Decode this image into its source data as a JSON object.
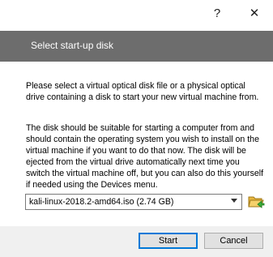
{
  "titlebar": {
    "help_label": "?",
    "close_label": "✕"
  },
  "header": {
    "title": "Select start-up disk"
  },
  "body": {
    "paragraph1": "Please select a virtual optical disk file or a physical optical drive containing a disk to start your new virtual machine from.",
    "paragraph2": "The disk should be suitable for starting a computer from and should contain the operating system you wish to install on the virtual machine if you want to do that now. The disk will be ejected from the virtual drive automatically next time you switch the virtual machine off, but you can also do this yourself if needed using the Devices menu."
  },
  "disk_select": {
    "value": "kali-linux-2018.2-amd64.iso (2.74 GB)",
    "icon": "folder-open-icon"
  },
  "buttons": {
    "start": "Start",
    "cancel": "Cancel"
  },
  "colors": {
    "header_bg": "#6d6d6d",
    "default_button_border": "#0078d7"
  }
}
